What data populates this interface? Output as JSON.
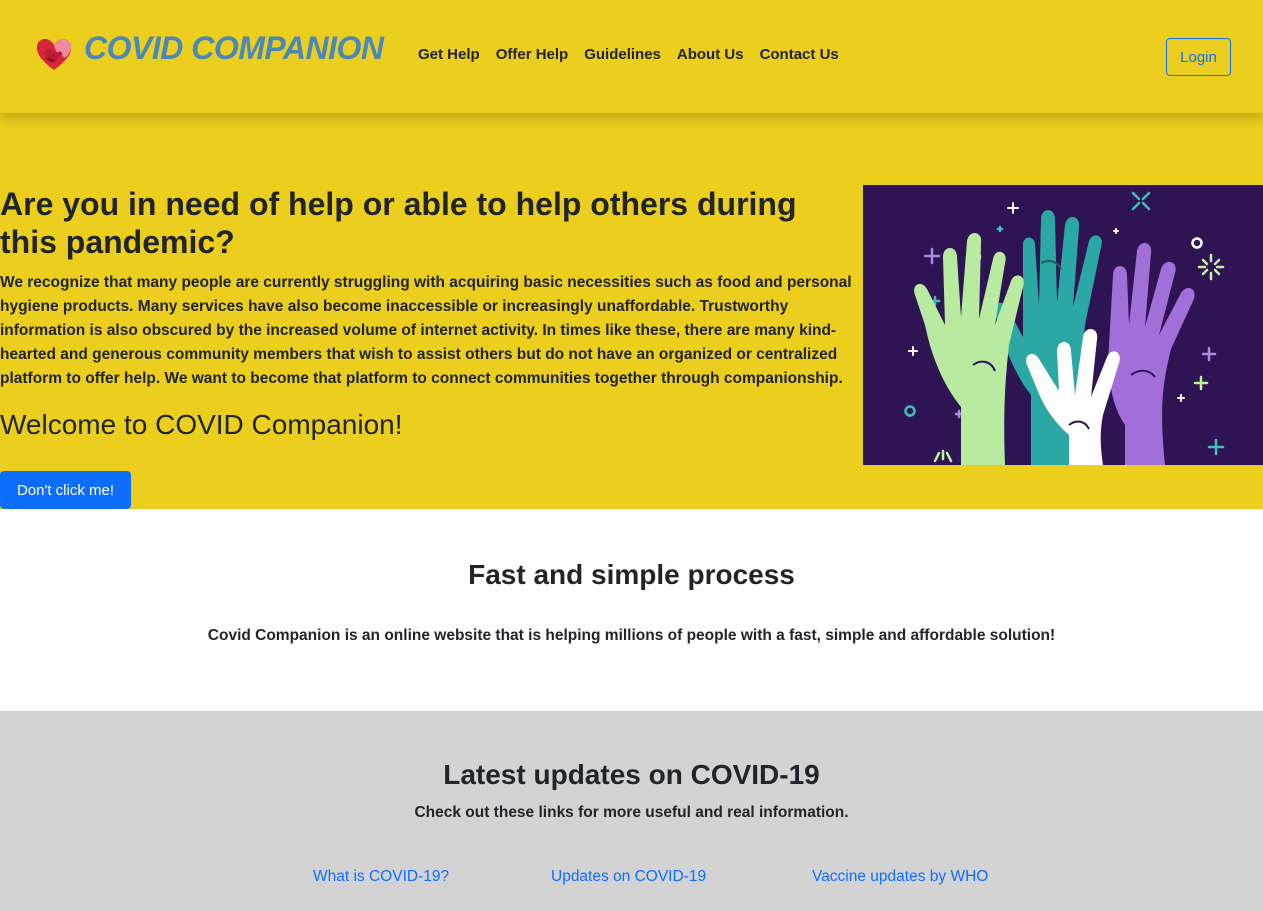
{
  "header": {
    "brand_name": "COVID COMPANION",
    "nav": [
      "Get Help",
      "Offer Help",
      "Guidelines",
      "About Us",
      "Contact Us"
    ],
    "login_label": "Login"
  },
  "hero": {
    "heading": "Are you in need of help or able to help others during this pandemic?",
    "paragraph": "We recognize that many people are currently struggling with acquiring basic necessities such as food and personal hygiene products. Many services have also become inaccessible or increasingly unaffordable. Trustworthy information is also obscured by the increased volume of internet activity. In times like these, there are many kind-hearted and generous community members that wish to assist others but do not have an organized or centralized platform to offer help. We want to become that platform to connect communities together through companionship.",
    "welcome": "Welcome to COVID Companion!",
    "button_label": "Don't click me!"
  },
  "process": {
    "title": "Fast and simple process",
    "description": "Covid Companion is an online website that is helping millions of people with a fast, simple and affordable solution!"
  },
  "updates": {
    "title": "Latest updates on COVID-19",
    "subtitle": "Check out these links for more useful and real information.",
    "links": [
      "What is COVID-19?",
      "Updates on COVID-19",
      "Vaccine updates by WHO"
    ]
  },
  "colors": {
    "header_bg": "#ecce1e",
    "brand_text": "#4a88b8",
    "accent": "#0d6efd",
    "updates_bg": "#d3d3d3",
    "illustration_bg": "#2e1453"
  },
  "icons": {
    "logo": "heart-hands-icon",
    "illustration": "raised-hands-illustration"
  }
}
